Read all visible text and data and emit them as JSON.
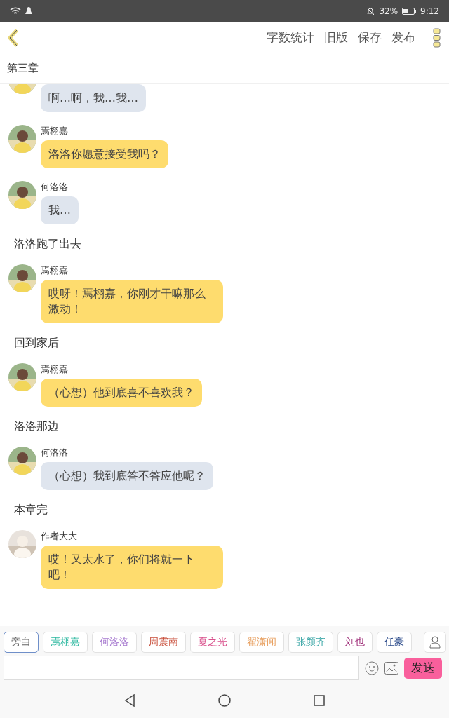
{
  "status_bar": {
    "battery": "32%",
    "time": "9:12"
  },
  "toolbar": {
    "actions": [
      "字数统计",
      "旧版",
      "保存",
      "发布"
    ]
  },
  "chapter_title": "第三章",
  "messages": [
    {
      "kind": "message",
      "text": "啊…啊，我…我…",
      "color": "#dfe5ee"
    },
    {
      "kind": "message",
      "name": "焉栩嘉",
      "text": "洛洛你愿意接受我吗？",
      "color": "#fedc6e"
    },
    {
      "kind": "message",
      "name": "何洛洛",
      "text": "我…",
      "color": "#dfe5ee"
    },
    {
      "kind": "narration",
      "text": "洛洛跑了出去"
    },
    {
      "kind": "message",
      "name": "焉栩嘉",
      "text": "哎呀！焉栩嘉，你刚才干嘛那么激动！",
      "color": "#fedc6e"
    },
    {
      "kind": "narration",
      "text": "回到家后"
    },
    {
      "kind": "message",
      "name": "焉栩嘉",
      "text": "（心想）他到底喜不喜欢我？",
      "color": "#fedc6e"
    },
    {
      "kind": "narration",
      "text": "洛洛那边"
    },
    {
      "kind": "message",
      "name": "何洛洛",
      "text": "（心想）我到底答不答应他呢？",
      "color": "#dfe5ee"
    },
    {
      "kind": "narration",
      "text": "本章完"
    },
    {
      "kind": "message",
      "name": "作者大大",
      "text": "哎！又太水了，你们将就一下吧！",
      "color": "#fedc6e"
    }
  ],
  "roles": [
    {
      "label": "旁白",
      "selected": true,
      "color": "#666666"
    },
    {
      "label": "焉栩嘉",
      "selected": false,
      "color": "#2cb8a0"
    },
    {
      "label": "何洛洛",
      "selected": false,
      "color": "#a77ad0"
    },
    {
      "label": "周震南",
      "selected": false,
      "color": "#c9503c"
    },
    {
      "label": "夏之光",
      "selected": false,
      "color": "#d9508c"
    },
    {
      "label": "翟潇闻",
      "selected": false,
      "color": "#e8a060"
    },
    {
      "label": "张颜齐",
      "selected": false,
      "color": "#3ea8a8"
    },
    {
      "label": "刘也",
      "selected": false,
      "color": "#a0307a"
    },
    {
      "label": "任豪",
      "selected": false,
      "color": "#2a4a8a"
    }
  ],
  "composer": {
    "send": "发送"
  }
}
